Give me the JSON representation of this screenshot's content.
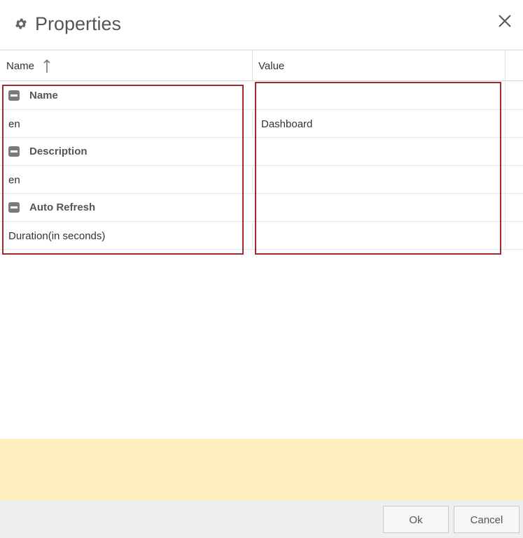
{
  "dialog": {
    "title": "Properties",
    "icon": "gear-icon",
    "close_icon": "close-icon"
  },
  "grid": {
    "columns": [
      {
        "label": "Name",
        "sort": "ascending"
      },
      {
        "label": "Value"
      }
    ],
    "groups": [
      {
        "label": "Name",
        "properties": [
          {
            "label": "en",
            "value": "Dashboard"
          }
        ]
      },
      {
        "label": "Description",
        "properties": [
          {
            "label": "en",
            "value": ""
          }
        ]
      },
      {
        "label": "Auto Refresh",
        "properties": [
          {
            "label": "Duration(in seconds)",
            "value": ""
          }
        ]
      }
    ]
  },
  "footer": {
    "ok_label": "Ok",
    "cancel_label": "Cancel"
  },
  "colors": {
    "highlight": "#a32a2a",
    "notice_bg": "#feefbf",
    "footer_bg": "#efefef"
  }
}
